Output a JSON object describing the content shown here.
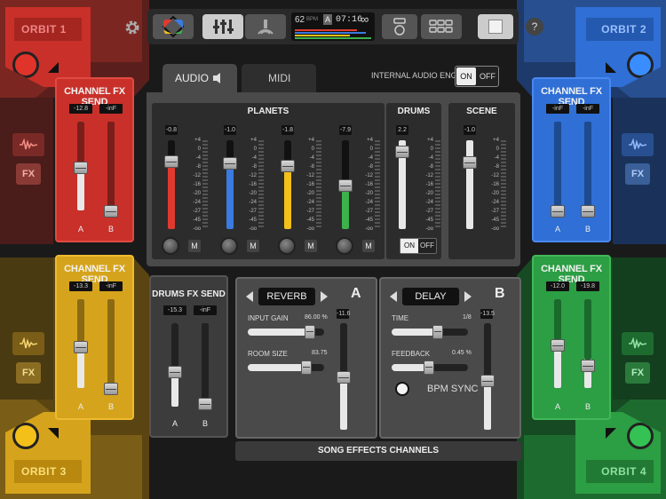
{
  "toolbar": {
    "bpm_value": "62",
    "bpm_unit": "BPM",
    "mode_letter": "A",
    "time": "07:16",
    "loop_symbol": "∞",
    "help_label": "?"
  },
  "orbits": [
    {
      "name": "ORBIT 1",
      "color": "#c9302a"
    },
    {
      "name": "ORBIT 2",
      "color": "#2f6fd6"
    },
    {
      "name": "ORBIT 3",
      "color": "#d6a41c"
    },
    {
      "name": "ORBIT 4",
      "color": "#2c9e44"
    }
  ],
  "side_buttons": {
    "fx_label": "FX"
  },
  "channel_fx_send": {
    "title": "CHANNEL FX SEND",
    "red": {
      "a": "-12.8",
      "b": "-inF",
      "label_a": "A",
      "label_b": "B"
    },
    "blue": {
      "a": "-inF",
      "b": "-inF",
      "label_a": "A",
      "label_b": "B"
    },
    "yellow": {
      "a": "-13.3",
      "b": "-inF",
      "label_a": "A",
      "label_b": "B"
    },
    "green": {
      "a": "-12.0",
      "b": "-19.8",
      "label_a": "A",
      "label_b": "B"
    }
  },
  "tabs": {
    "audio": "AUDIO",
    "midi": "MIDI"
  },
  "engine": {
    "label": "INTERNAL AUDIO ENGINE",
    "on": "ON",
    "off": "OFF"
  },
  "mixer": {
    "planets_title": "PLANETS",
    "drums_title": "DRUMS",
    "scene_title": "SCENE",
    "channels": [
      {
        "value": "-0.8",
        "color": "#e03a2f"
      },
      {
        "value": "-1.0",
        "color": "#3a7be0"
      },
      {
        "value": "-1.8",
        "color": "#f2c019"
      },
      {
        "value": "-7.9",
        "color": "#3cb24c"
      }
    ],
    "drums_value": "2.2",
    "scene_value": "-1.0",
    "mute_label": "M",
    "drums_on": "ON",
    "drums_off": "OFF",
    "scale": [
      "+4",
      "0",
      "-4",
      "-8",
      "-12",
      "-16",
      "-20",
      "-24",
      "-27",
      "-45",
      "-oo"
    ]
  },
  "drums_fx_send": {
    "title": "DRUMS FX SEND",
    "a": "-15.3",
    "b": "-inF",
    "label_a": "A",
    "label_b": "B"
  },
  "effect_a": {
    "letter": "A",
    "name": "REVERB",
    "p1_label": "INPUT GAIN",
    "p1_value": "86.00 %",
    "p1_level": 0.86,
    "p2_label": "ROOM SIZE",
    "p2_value": "83.75",
    "p2_level": 0.84,
    "fader_value": "-11.6"
  },
  "effect_b": {
    "letter": "B",
    "name": "DELAY",
    "p1_label": "TIME",
    "p1_value": "1/8",
    "p1_level": 0.62,
    "p2_label": "FEEDBACK",
    "p2_value": "0.45 %",
    "p2_level": 0.45,
    "sync_label": "BPM SYNC",
    "fader_value": "-13.5"
  },
  "effects_footer": "SONG EFFECTS CHANNELS"
}
